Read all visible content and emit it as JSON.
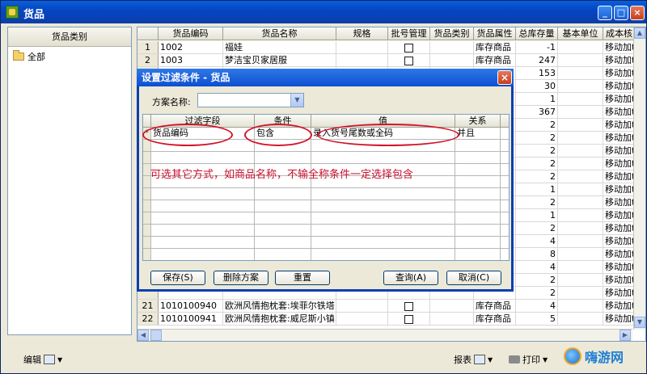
{
  "window": {
    "title": "货品"
  },
  "left_panel": {
    "header": "货品类别",
    "tree_root": "全部"
  },
  "grid": {
    "columns": [
      "",
      "货品编码",
      "货品名称",
      "规格",
      "批号管理",
      "货品类别",
      "货品属性",
      "总库存量",
      "基本单位",
      "成本核"
    ],
    "rows": [
      {
        "n": "1",
        "code": "1002",
        "name": "福娃",
        "attr": "库存商品",
        "qty": "-1",
        "cost": "移动加t"
      },
      {
        "n": "2",
        "code": "1003",
        "name": "梦洁宝贝家居服",
        "attr": "库存商品",
        "qty": "247",
        "cost": "移动加t"
      },
      {
        "n": "",
        "code": "",
        "name": "",
        "attr": "",
        "qty": "153",
        "cost": "移动加t"
      },
      {
        "n": "",
        "code": "",
        "name": "",
        "attr": "",
        "qty": "30",
        "cost": "移动加t"
      },
      {
        "n": "",
        "code": "",
        "name": "",
        "attr": "",
        "qty": "1",
        "cost": "移动加t"
      },
      {
        "n": "",
        "code": "",
        "name": "",
        "attr": "",
        "qty": "367",
        "cost": "移动加t"
      },
      {
        "n": "",
        "code": "",
        "name": "",
        "attr": "",
        "qty": "2",
        "cost": "移动加t"
      },
      {
        "n": "",
        "code": "",
        "name": "",
        "attr": "",
        "qty": "2",
        "cost": "移动加t"
      },
      {
        "n": "",
        "code": "",
        "name": "",
        "attr": "",
        "qty": "2",
        "cost": "移动加t"
      },
      {
        "n": "",
        "code": "",
        "name": "",
        "attr": "",
        "qty": "2",
        "cost": "移动加t"
      },
      {
        "n": "",
        "code": "",
        "name": "",
        "attr": "",
        "qty": "2",
        "cost": "移动加t"
      },
      {
        "n": "",
        "code": "",
        "name": "",
        "attr": "",
        "qty": "1",
        "cost": "移动加t"
      },
      {
        "n": "",
        "code": "",
        "name": "",
        "attr": "",
        "qty": "2",
        "cost": "移动加t"
      },
      {
        "n": "",
        "code": "",
        "name": "",
        "attr": "",
        "qty": "1",
        "cost": "移动加t"
      },
      {
        "n": "",
        "code": "",
        "name": "",
        "attr": "",
        "qty": "2",
        "cost": "移动加t"
      },
      {
        "n": "",
        "code": "",
        "name": "",
        "attr": "",
        "qty": "4",
        "cost": "移动加t"
      },
      {
        "n": "",
        "code": "",
        "name": "",
        "attr": "",
        "qty": "8",
        "cost": "移动加t"
      },
      {
        "n": "",
        "code": "",
        "name": "",
        "attr": "",
        "qty": "4",
        "cost": "移动加t"
      },
      {
        "n": "",
        "code": "",
        "name": "",
        "attr": "",
        "qty": "2",
        "cost": "移动加t"
      },
      {
        "n": "",
        "code": "",
        "name": "",
        "attr": "",
        "qty": "2",
        "cost": "移动加t"
      },
      {
        "n": "21",
        "code": "1010100940",
        "name": "欧洲风情抱枕套:埃菲尔铁塔",
        "attr": "库存商品",
        "qty": "4",
        "cost": "移动加t"
      },
      {
        "n": "22",
        "code": "1010100941",
        "name": "欧洲风情抱枕套:威尼斯小镇",
        "attr": "库存商品",
        "qty": "5",
        "cost": "移动加t"
      }
    ]
  },
  "dialog": {
    "title": "设置过滤条件 - 货品",
    "scheme_label": "方案名称:",
    "scheme_value": "",
    "columns": [
      "过滤字段",
      "条件",
      "值",
      "关系"
    ],
    "row": {
      "field": "货品编码",
      "condition": "包含",
      "value": "录入货号尾数或全码",
      "relation": "并且"
    },
    "annotation": "可选其它方式，如商品名称，不输全称条件一定选择包含",
    "buttons": {
      "save": "保存(S)",
      "delete": "删除方案",
      "reset": "重置",
      "query": "查询(A)",
      "cancel": "取消(C)"
    }
  },
  "toolbar": {
    "edit": "编辑",
    "report": "报表",
    "print": "打印"
  },
  "watermark": {
    "text": "嗨游网"
  }
}
